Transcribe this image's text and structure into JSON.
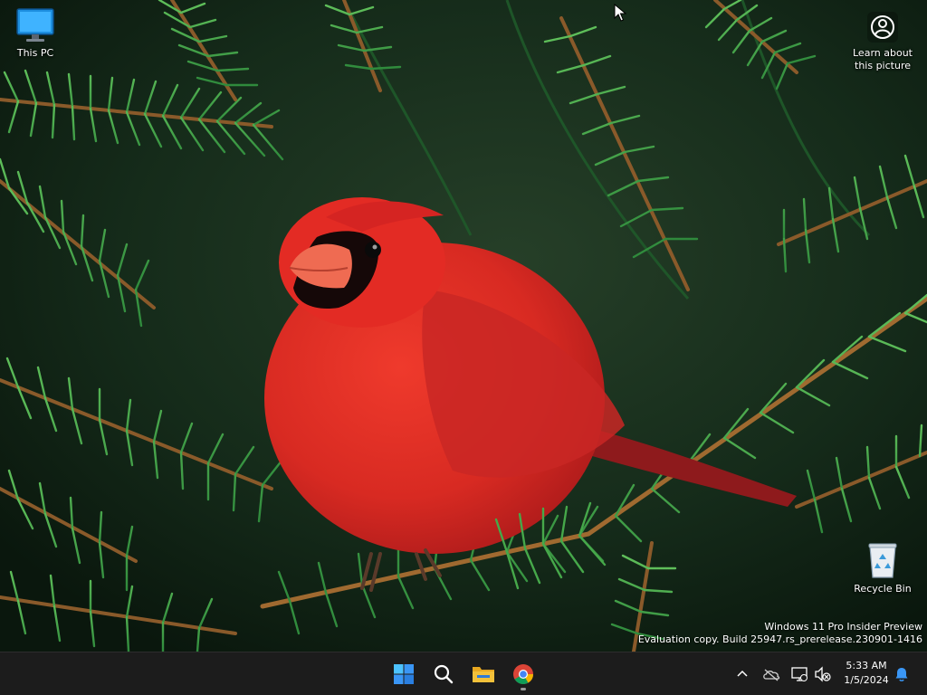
{
  "desktop": {
    "icons": [
      {
        "label": "This PC",
        "icon": "this-pc-icon"
      },
      {
        "label": "Learn about this picture",
        "icon": "learn-about-picture-icon"
      },
      {
        "label": "Recycle Bin",
        "icon": "recycle-bin-icon"
      }
    ],
    "watermark": {
      "line1": "Windows 11 Pro Insider Preview",
      "line2": "Evaluation copy. Build 25947.rs_prerelease.230901-1416"
    }
  },
  "taskbar": {
    "pinned": [
      {
        "name": "Start",
        "icon": "windows-start-icon"
      },
      {
        "name": "Search",
        "icon": "search-icon"
      },
      {
        "name": "File Explorer",
        "icon": "folder-icon"
      },
      {
        "name": "Google Chrome",
        "icon": "chrome-icon",
        "running": true
      }
    ],
    "tray": {
      "icons": [
        "chevron-up-icon",
        "onedrive-icon",
        "network-icon",
        "volume-muted-icon",
        "notification-bell-icon"
      ],
      "time": "5:33 AM",
      "date": "1/5/2024"
    }
  },
  "colors": {
    "taskbar_bg": "#1c1c1c",
    "start_blue": "#3a96f5",
    "folder_yellow": "#f3c13a",
    "accent": "#0078d4"
  }
}
